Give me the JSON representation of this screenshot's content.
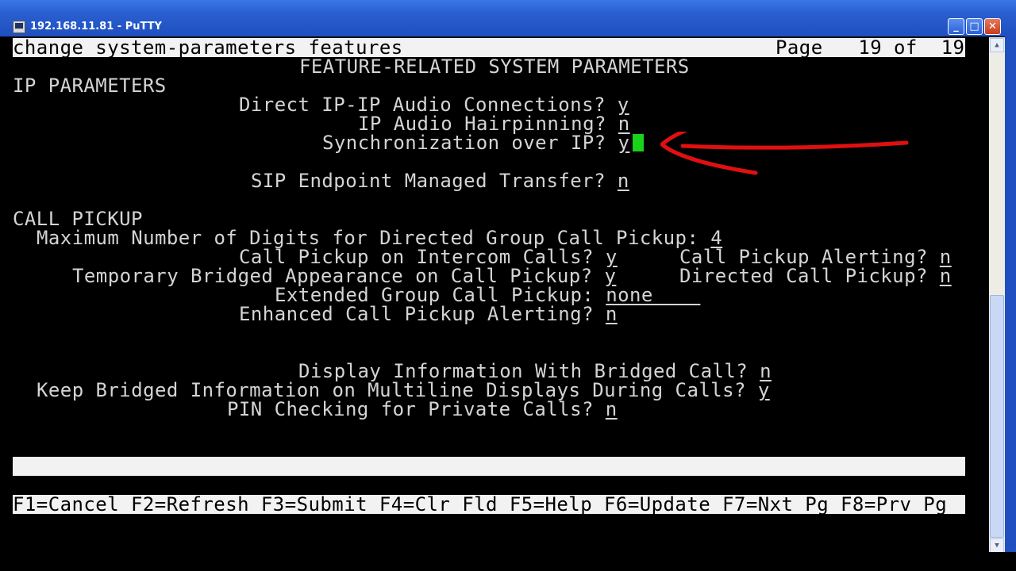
{
  "window": {
    "title": "192.168.11.81 - PuTTY",
    "buttons": {
      "minimize": "_",
      "maximize": "□",
      "close": "✕"
    }
  },
  "screen": {
    "header": {
      "command": "change system-parameters features",
      "page_label": "Page",
      "page_current": "19",
      "page_of": "of",
      "page_total": "19"
    },
    "form_title": "FEATURE-RELATED SYSTEM PARAMETERS",
    "ip_section": {
      "title": "IP PARAMETERS",
      "direct_ip_ip_label": "Direct IP-IP Audio Connections?",
      "direct_ip_ip_value": "y",
      "hairpinning_label": "IP Audio Hairpinning?",
      "hairpinning_value": "n",
      "sync_ip_label": "Synchronization over IP?",
      "sync_ip_value": "y",
      "sip_transfer_label": "SIP Endpoint Managed Transfer?",
      "sip_transfer_value": "n"
    },
    "call_pickup": {
      "title": "CALL PICKUP",
      "max_digits_label": "Maximum Number of Digits for Directed Group Call Pickup:",
      "max_digits_value": "4",
      "intercom_label": "Call Pickup on Intercom Calls?",
      "intercom_value": "y",
      "alerting_label": "Call Pickup Alerting?",
      "alerting_value": "n",
      "temp_bridged_label": "Temporary Bridged Appearance on Call Pickup?",
      "temp_bridged_value": "y",
      "directed_label": "Directed Call Pickup?",
      "directed_value": "n",
      "extended_label": "Extended Group Call Pickup:",
      "extended_value": "none    ",
      "enhanced_label": "Enhanced Call Pickup Alerting?",
      "enhanced_value": "n"
    },
    "bridged": {
      "display_info_label": "Display Information With Bridged Call?",
      "display_info_value": "n",
      "keep_bridged_label": "Keep Bridged Information on Multiline Displays During Calls?",
      "keep_bridged_value": "y",
      "pin_label": "PIN Checking for Private Calls?",
      "pin_value": "n"
    },
    "function_keys": [
      "F1=Cancel",
      "F2=Refresh",
      "F3=Submit",
      "F4=Clr Fld",
      "F5=Help",
      "F6=Update",
      "F7=Nxt Pg",
      "F8=Prv Pg"
    ]
  },
  "colors": {
    "terminal_bg": "#000000",
    "terminal_fg": "#d4d4d4",
    "inverse_bg": "#f2f2f2",
    "cursor": "#19d21a",
    "annotation": "#e01010",
    "titlebar": "#2a5fd0"
  }
}
